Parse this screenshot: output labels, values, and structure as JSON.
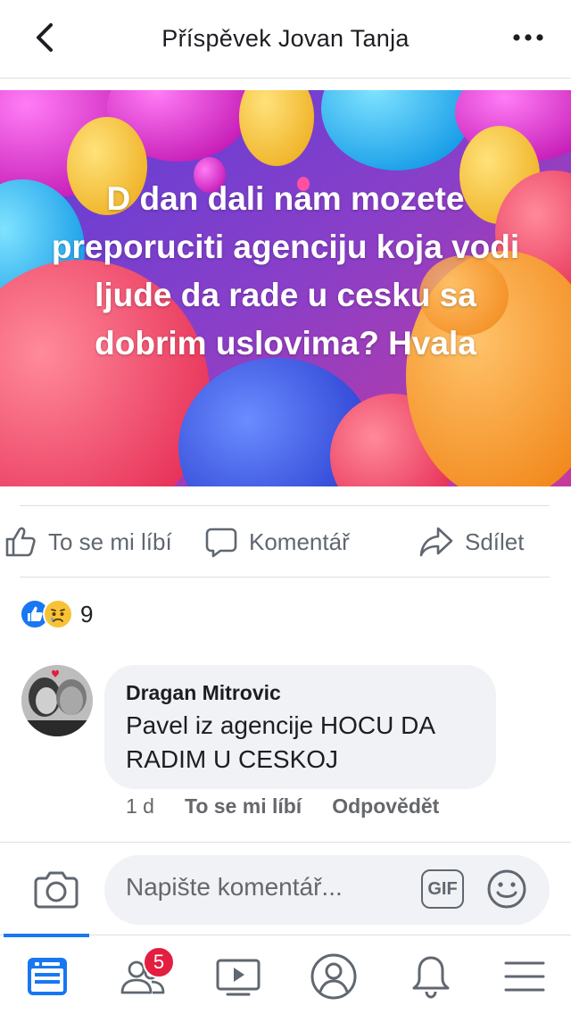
{
  "header": {
    "title": "Příspěvek Jovan Tanja",
    "back_icon": "chevron-left-icon",
    "more_icon": "more-horizontal-icon"
  },
  "post": {
    "text": "D dan dali nam mozete preporuciti agenciju koja vodi ljude da rade u cesku sa dobrim uslovima? Hvala",
    "background": "balloons"
  },
  "actions": {
    "like_label": "To se mi líbí",
    "comment_label": "Komentář",
    "share_label": "Sdílet"
  },
  "reactions": {
    "types": [
      "like",
      "sad"
    ],
    "count": "9"
  },
  "comment": {
    "author": "Dragan Mitrovic",
    "text": "Pavel iz agencije HOCU DA RADIM U CESKOJ",
    "time": "1 d",
    "like_label": "To se mi líbí",
    "reply_label": "Odpovědět"
  },
  "composer": {
    "placeholder": "Napište komentář...",
    "gif_label": "GIF"
  },
  "tabbar": {
    "items": [
      "news-feed",
      "friends",
      "watch",
      "profile",
      "notifications",
      "menu"
    ],
    "friends_badge": "5"
  },
  "colors": {
    "accent": "#1877f2",
    "badge": "#e41e3f",
    "text_secondary": "#606770"
  }
}
